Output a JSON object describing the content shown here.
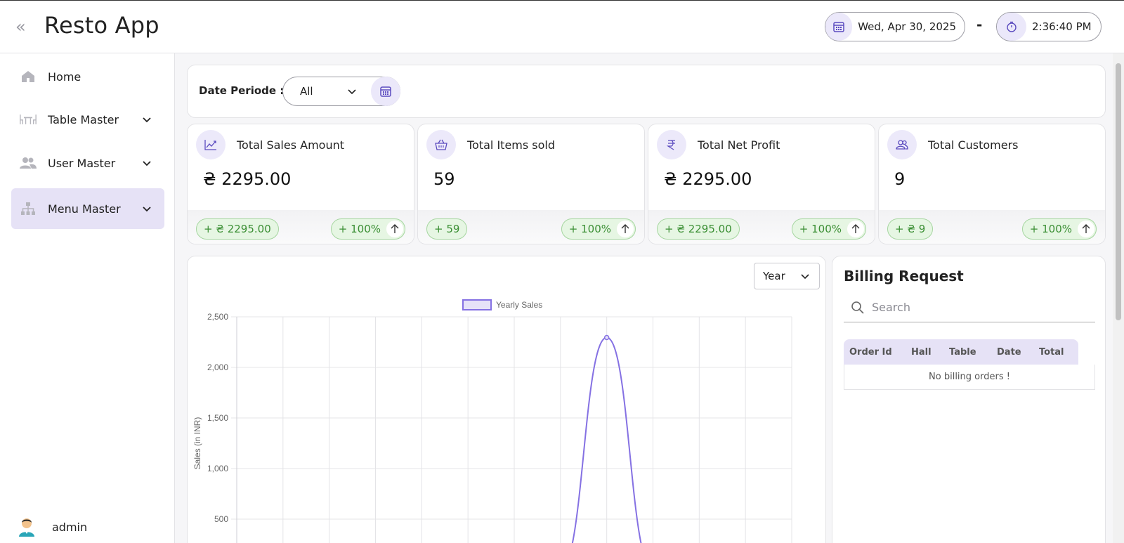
{
  "header": {
    "app_title": "Resto App",
    "date": "Wed, Apr 30, 2025",
    "separator": "-",
    "time": "2:36:40 PM"
  },
  "sidebar": {
    "items": [
      {
        "label": "Home",
        "icon": "home-icon",
        "has_submenu": false,
        "active": false
      },
      {
        "label": "Table Master",
        "icon": "dining-table-icon",
        "has_submenu": true,
        "active": false
      },
      {
        "label": "User Master",
        "icon": "users-icon",
        "has_submenu": true,
        "active": false
      },
      {
        "label": "Menu Master",
        "icon": "sitemap-icon",
        "has_submenu": true,
        "active": true
      }
    ],
    "user": "admin"
  },
  "filter": {
    "label": "Date Periode :",
    "selected": "All"
  },
  "stats": [
    {
      "title": "Total Sales Amount",
      "icon": "trend-chart-icon",
      "value": "₴ 2295.00",
      "delta": "+ ₴ 2295.00",
      "percent": "+ 100%"
    },
    {
      "title": "Total Items sold",
      "icon": "basket-icon",
      "value": "59",
      "delta": "+ 59",
      "percent": "+ 100%"
    },
    {
      "title": "Total Net Profit",
      "icon": "rupee-icon",
      "value": "₴ 2295.00",
      "delta": "+ ₴ 2295.00",
      "percent": "+ 100%"
    },
    {
      "title": "Total Customers",
      "icon": "customers-icon",
      "value": "9",
      "delta": "+ ₴ 9",
      "percent": "+ 100%"
    }
  ],
  "chart_period": "Year",
  "chart_data": {
    "type": "line",
    "legend": "Yearly Sales",
    "ylabel": "Sales (in INR)",
    "ylim": [
      0,
      2500
    ],
    "yticks": [
      "2,500",
      "2,000",
      "1,500",
      "1,000",
      "500"
    ],
    "x_points": 12,
    "series": [
      {
        "name": "Yearly Sales",
        "values": [
          0,
          0,
          0,
          0,
          0,
          0,
          0,
          0,
          2295,
          0,
          0,
          0
        ]
      }
    ],
    "color": "#8571e3"
  },
  "billing": {
    "title": "Billing Request",
    "search_placeholder": "Search",
    "columns": [
      "Order Id",
      "Hall",
      "Table",
      "Date",
      "Total"
    ],
    "empty_text": "No billing orders !"
  },
  "colors": {
    "accent": "#8571e3",
    "accent_light": "#ebe8fa",
    "badge_green": "#3b8f34"
  }
}
